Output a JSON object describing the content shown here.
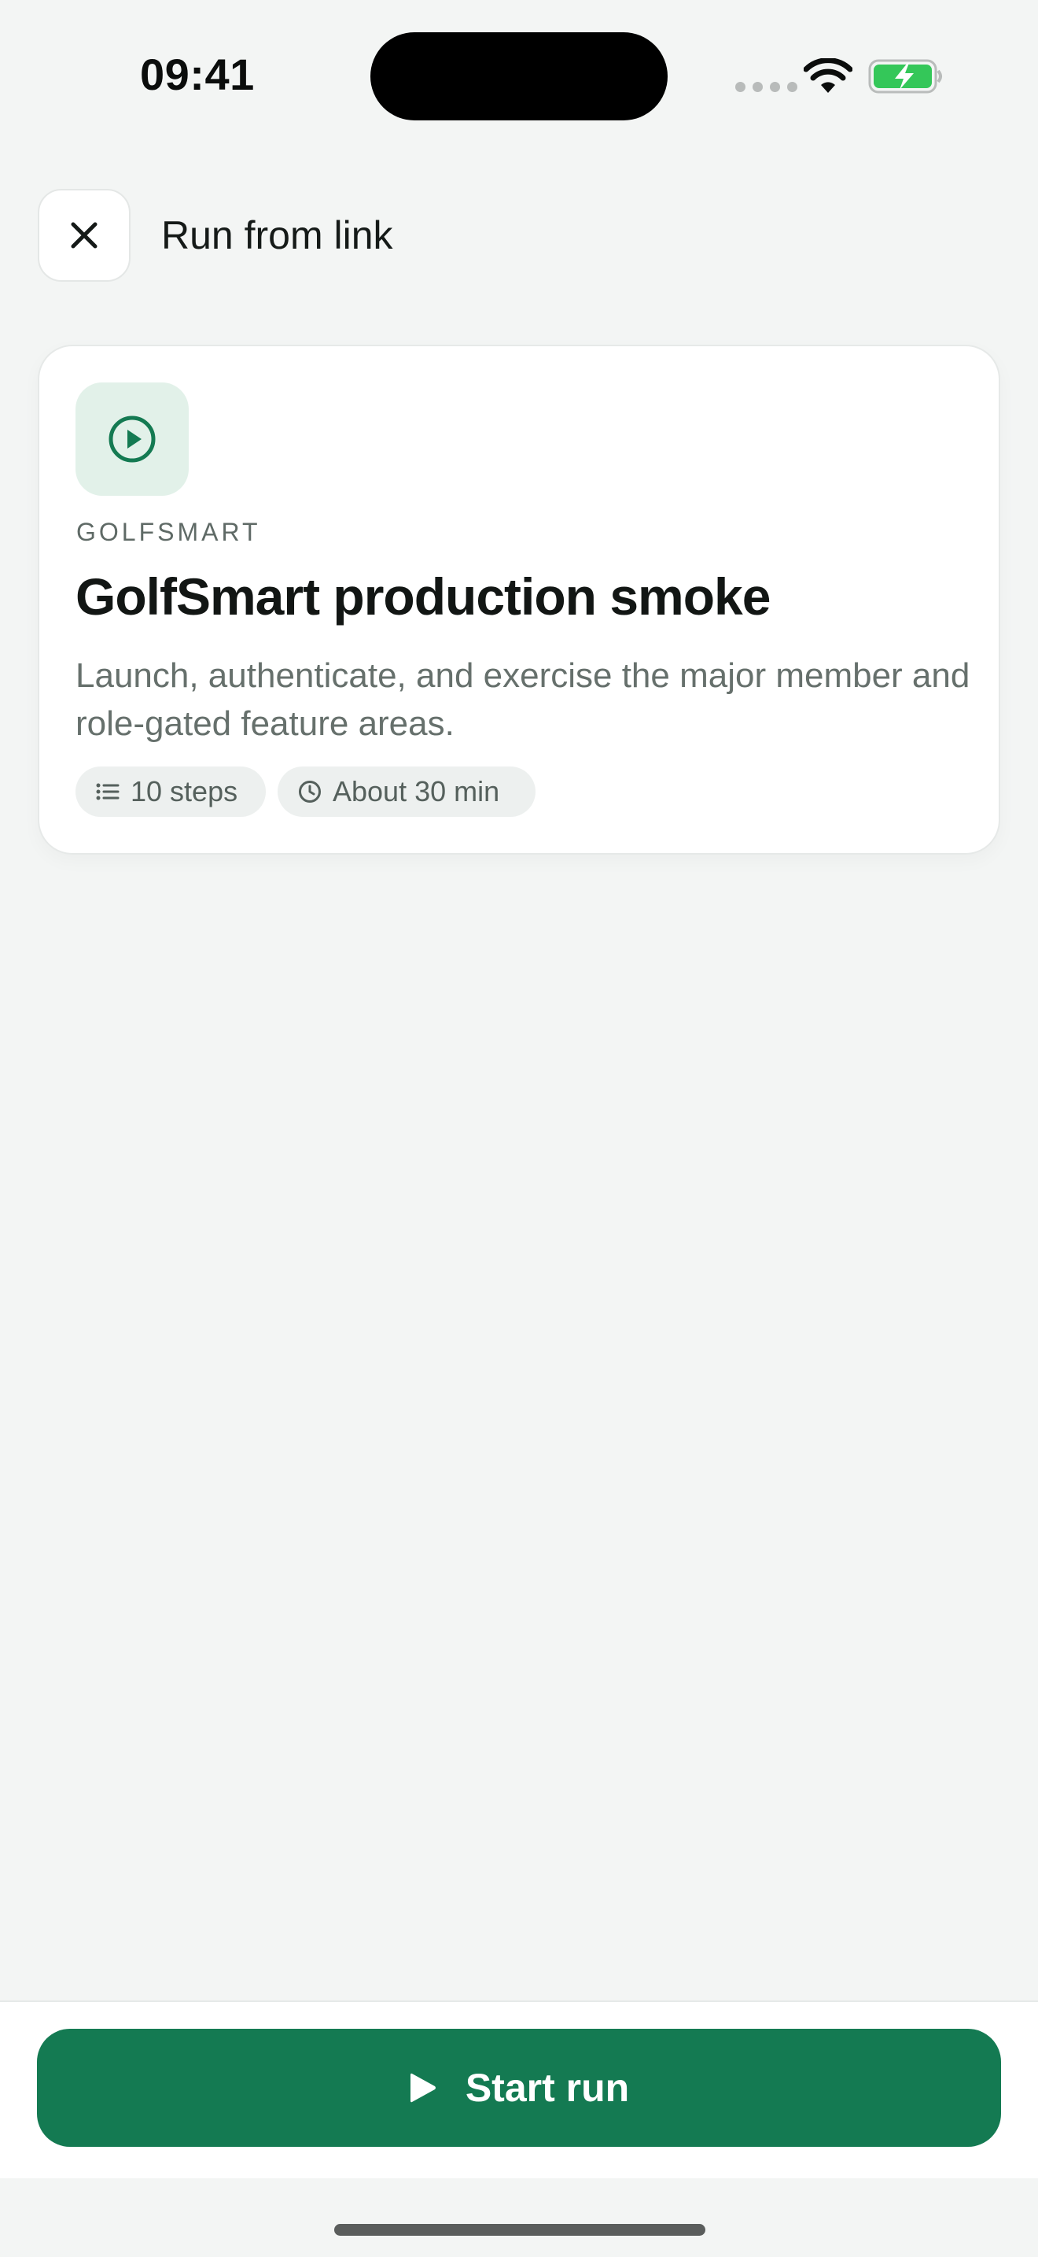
{
  "status_bar": {
    "time": "09:41"
  },
  "header": {
    "title": "Run from link",
    "close_icon": "close-icon"
  },
  "flow_card": {
    "icon": "play-circle-icon",
    "org": "GOLFSMART",
    "title": "GolfSmart production smoke",
    "description": "Launch, authenticate, and exercise the major member and role-gated feature areas.",
    "chips": {
      "steps": "10 steps",
      "duration": "About 30 min"
    }
  },
  "footer": {
    "start_label": "Start run"
  },
  "colors": {
    "accent": "#147a52",
    "icon_tile": "#e2f1e9",
    "background": "#f3f5f4",
    "battery": "#34c759"
  }
}
